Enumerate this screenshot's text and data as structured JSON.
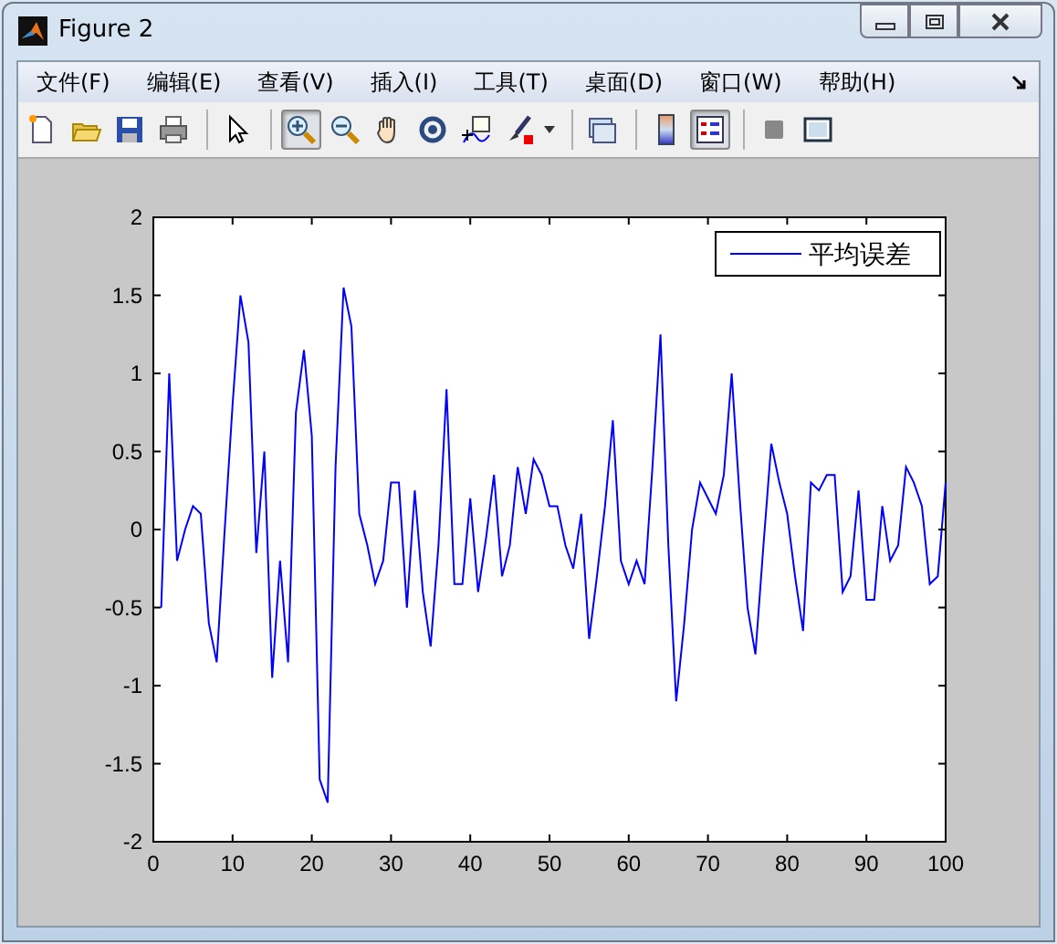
{
  "window": {
    "title": "Figure 2"
  },
  "menu": [
    "文件(F)",
    "编辑(E)",
    "查看(V)",
    "插入(I)",
    "工具(T)",
    "桌面(D)",
    "窗口(W)",
    "帮助(H)"
  ],
  "toolbar": [
    {
      "selected": false
    },
    {
      "selected": false
    },
    {
      "selected": false
    },
    {
      "selected": false
    },
    {
      "selected": false
    },
    {
      "selected": true
    },
    {
      "selected": false
    },
    {
      "selected": false
    },
    {
      "selected": false
    },
    {
      "selected": false
    },
    {
      "selected": false
    },
    {
      "selected": false
    },
    {
      "selected": false
    },
    {
      "selected": true
    },
    {
      "selected": false
    },
    {
      "selected": false
    }
  ],
  "figure": {
    "chart_data": {
      "type": "line",
      "xlim": [
        0,
        100
      ],
      "ylim": [
        -2,
        2
      ],
      "xticks": [
        0,
        10,
        20,
        30,
        40,
        50,
        60,
        70,
        80,
        90,
        100
      ],
      "yticks": [
        -2,
        -1.5,
        -1,
        -0.5,
        0,
        0.5,
        1,
        1.5,
        2
      ],
      "x": [
        1,
        2,
        3,
        4,
        5,
        6,
        7,
        8,
        9,
        10,
        11,
        12,
        13,
        14,
        15,
        16,
        17,
        18,
        19,
        20,
        21,
        22,
        23,
        24,
        25,
        26,
        27,
        28,
        29,
        30,
        31,
        32,
        33,
        34,
        35,
        36,
        37,
        38,
        39,
        40,
        41,
        42,
        43,
        44,
        45,
        46,
        47,
        48,
        49,
        50,
        51,
        52,
        53,
        54,
        55,
        56,
        57,
        58,
        59,
        60,
        61,
        62,
        63,
        64,
        65,
        66,
        67,
        68,
        69,
        70,
        71,
        72,
        73,
        74,
        75,
        76,
        77,
        78,
        79,
        80,
        81,
        82,
        83,
        84,
        85,
        86,
        87,
        88,
        89,
        90,
        91,
        92,
        93,
        94,
        95,
        96,
        97,
        98,
        99,
        100
      ],
      "series": [
        {
          "name": "平均误差",
          "color": "#0000ff",
          "values": [
            -0.5,
            1.0,
            -0.2,
            0,
            0.15,
            0.1,
            -0.6,
            -0.85,
            0,
            0.8,
            1.5,
            1.2,
            -0.15,
            0.5,
            -0.95,
            -0.2,
            -0.85,
            0.75,
            1.15,
            0.6,
            -1.6,
            -1.75,
            0.4,
            1.55,
            1.3,
            0.1,
            -0.1,
            -0.35,
            -0.2,
            0.3,
            0.3,
            -0.5,
            0.25,
            -0.4,
            -0.75,
            -0.1,
            0.9,
            -0.35,
            -0.35,
            0.2,
            -0.4,
            -0.05,
            0.35,
            -0.3,
            -0.1,
            0.4,
            0.1,
            0.45,
            0.35,
            0.15,
            0.15,
            -0.1,
            -0.25,
            0.1,
            -0.7,
            -0.3,
            0.15,
            0.7,
            -0.2,
            -0.35,
            -0.2,
            -0.35,
            0.4,
            1.25,
            -0.1,
            -1.1,
            -0.6,
            0,
            0.3,
            0.2,
            0.1,
            0.35,
            1.0,
            0.2,
            -0.5,
            -0.8,
            -0.1,
            0.55,
            0.3,
            0.1,
            -0.3,
            -0.65,
            0.3,
            0.25,
            0.35,
            0.35,
            -0.4,
            -0.3,
            0.25,
            -0.45,
            -0.45,
            0.15,
            -0.2,
            -0.1,
            0.4,
            0.3,
            0.15,
            -0.35,
            -0.3,
            0.3
          ]
        }
      ]
    }
  }
}
